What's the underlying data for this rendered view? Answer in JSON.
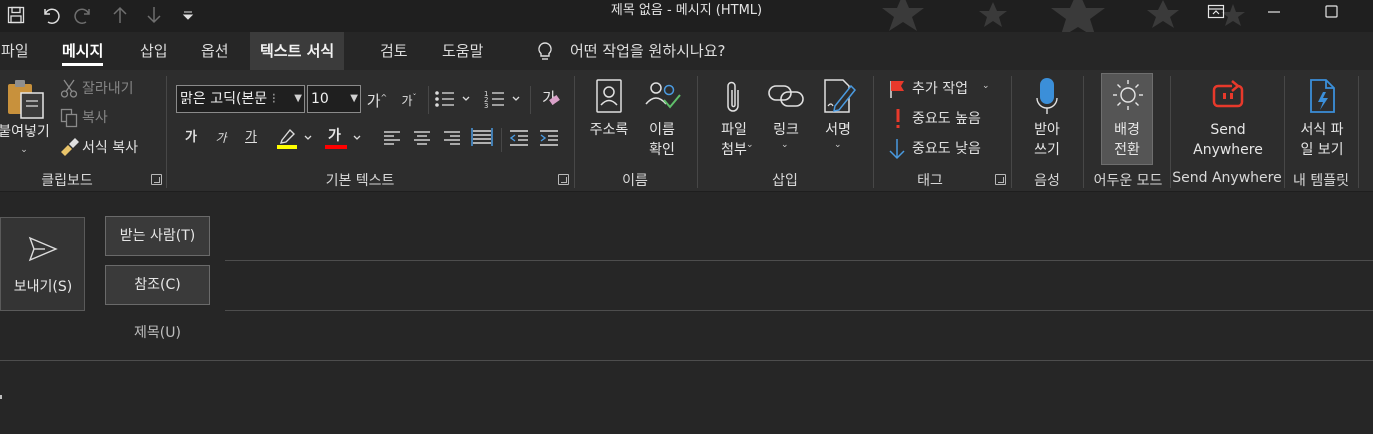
{
  "window": {
    "title": "제목 없음  -  메시지 (HTML)"
  },
  "quick_access": {
    "icons": [
      "save-icon",
      "undo-icon",
      "redo-icon",
      "up-arrow-icon",
      "down-arrow-icon",
      "customize-qat-icon"
    ]
  },
  "window_controls": [
    "ribbon-display-icon",
    "minimize-icon",
    "maximize-icon"
  ],
  "tabs": [
    {
      "label": "파일"
    },
    {
      "label": "메시지"
    },
    {
      "label": "삽입"
    },
    {
      "label": "옵션"
    },
    {
      "label": "텍스트 서식"
    },
    {
      "label": "검토"
    },
    {
      "label": "도움말"
    }
  ],
  "tell_me": {
    "label": "어떤 작업을 원하시나요?",
    "icon": "lightbulb-icon"
  },
  "ribbon": {
    "clipboard": {
      "group_label": "클립보드",
      "paste": "붙여넣기",
      "cut": "잘라내기",
      "copy": "복사",
      "format_painter": "서식 복사"
    },
    "basic_text": {
      "group_label": "기본 텍스트",
      "font_name": "맑은 고딕(본문",
      "font_size": "10",
      "grow_font": "가",
      "shrink_font": "가",
      "bold": "가",
      "italic": "가",
      "underline": "가",
      "font_color_glyph": "가",
      "clear_format_glyph": "가",
      "highlight_color": "#ffff00",
      "font_color": "#ff0000"
    },
    "names": {
      "group_label": "이름",
      "address_book": "주소록",
      "check_names": "이름\n확인"
    },
    "include": {
      "group_label": "삽입",
      "attach_file": "파일\n첨부",
      "link": "링크",
      "signature": "서명"
    },
    "tags": {
      "group_label": "태그",
      "follow_up": "추가 작업",
      "high_importance": "중요도 높음",
      "low_importance": "중요도 낮음"
    },
    "voice": {
      "group_label": "음성",
      "dictate": "받아\n쓰기"
    },
    "dark_mode": {
      "group_label": "어두운 모드",
      "switch_background": "배경\n전환"
    },
    "send_anywhere": {
      "group_label": "Send Anywhere",
      "button": "Send\nAnywhere"
    },
    "templates": {
      "group_label": "내 템플릿",
      "view_templates": "서식 파\n일 보기"
    }
  },
  "compose": {
    "send": "보내기(S)",
    "to": "받는 사람(T)",
    "cc": "참조(C)",
    "subject": "제목(U)"
  },
  "colors": {
    "titlebar": "#1f1f1f",
    "ribbon": "#2d2d2d",
    "body": "#262626",
    "accent_red": "#e8392b",
    "accent_blue": "#3b8fd9"
  }
}
